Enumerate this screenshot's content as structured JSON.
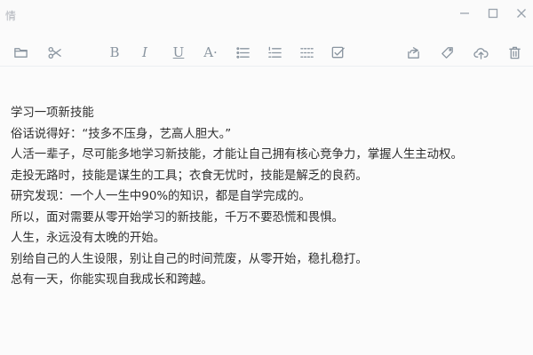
{
  "window": {
    "title": "情"
  },
  "toolbar": {
    "left": [
      {
        "name": "folder-icon"
      },
      {
        "name": "scissors-icon"
      },
      {
        "name": "bold-button",
        "text": "B"
      },
      {
        "name": "italic-button",
        "text": "I"
      },
      {
        "name": "underline-button",
        "text": "U"
      },
      {
        "name": "font-color-button",
        "text": "A·"
      },
      {
        "name": "bullet-list-icon"
      },
      {
        "name": "numbered-list-icon"
      },
      {
        "name": "divider-icon"
      },
      {
        "name": "checkbox-icon"
      }
    ],
    "right": [
      {
        "name": "share-icon"
      },
      {
        "name": "tag-icon"
      },
      {
        "name": "cloud-upload-icon"
      },
      {
        "name": "trash-icon"
      }
    ]
  },
  "document": {
    "lines": [
      "学习一项新技能",
      "俗话说得好：“技多不压身，艺高人胆大。”",
      " 人活一辈子，尽可能多地学习新技能，才能让自己拥有核心竞争力，掌握人生主动权。",
      "走投无路时，技能是谋生的工具；衣食无忧时，技能是解乏的良药。",
      " 研究发现：一个人一生中90%的知识，都是自学完成的。",
      "所以，面对需要从零开始学习的新技能，千万不要恐慌和畏惧。",
      " 人生，永远没有太晚的开始。",
      "别给自己的人生设限，别让自己的时间荒废，从零开始，稳扎稳打。",
      "总有一天，你能实现自我成长和跨越。"
    ]
  }
}
